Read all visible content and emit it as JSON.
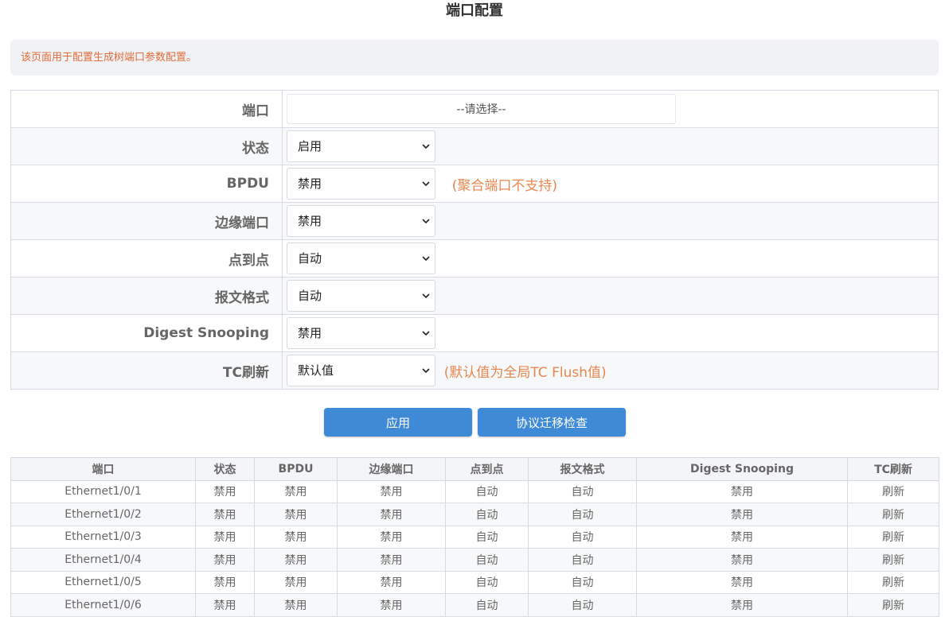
{
  "page": {
    "title": "端口配置",
    "description": "该页面用于配置生成树端口参数配置。"
  },
  "form": {
    "port": {
      "label": "端口",
      "value": "--请选择--"
    },
    "status": {
      "label": "状态",
      "value": "启用"
    },
    "bpdu": {
      "label": "BPDU",
      "value": "禁用",
      "note": "(聚合端口不支持)"
    },
    "edge_port": {
      "label": "边缘端口",
      "value": "禁用"
    },
    "p2p": {
      "label": "点到点",
      "value": "自动"
    },
    "packet_format": {
      "label": "报文格式",
      "value": "自动"
    },
    "digest_snooping": {
      "label": "Digest Snooping",
      "value": "禁用"
    },
    "tc_flush": {
      "label": "TC刷新",
      "value": "默认值",
      "note": "(默认值为全局TC Flush值)"
    }
  },
  "buttons": {
    "apply": "应用",
    "protocol_check": "协议迁移检查"
  },
  "table": {
    "headers": [
      "端口",
      "状态",
      "BPDU",
      "边缘端口",
      "点到点",
      "报文格式",
      "Digest Snooping",
      "TC刷新"
    ],
    "rows": [
      [
        "Ethernet1/0/1",
        "禁用",
        "禁用",
        "禁用",
        "自动",
        "自动",
        "禁用",
        "刷新"
      ],
      [
        "Ethernet1/0/2",
        "禁用",
        "禁用",
        "禁用",
        "自动",
        "自动",
        "禁用",
        "刷新"
      ],
      [
        "Ethernet1/0/3",
        "禁用",
        "禁用",
        "禁用",
        "自动",
        "自动",
        "禁用",
        "刷新"
      ],
      [
        "Ethernet1/0/4",
        "禁用",
        "禁用",
        "禁用",
        "自动",
        "自动",
        "禁用",
        "刷新"
      ],
      [
        "Ethernet1/0/5",
        "禁用",
        "禁用",
        "禁用",
        "自动",
        "自动",
        "禁用",
        "刷新"
      ],
      [
        "Ethernet1/0/6",
        "禁用",
        "禁用",
        "禁用",
        "自动",
        "自动",
        "禁用",
        "刷新"
      ]
    ]
  },
  "colors": {
    "accent": "#3f8ad6",
    "note": "#e8874e",
    "info_text": "#e06e3a"
  }
}
